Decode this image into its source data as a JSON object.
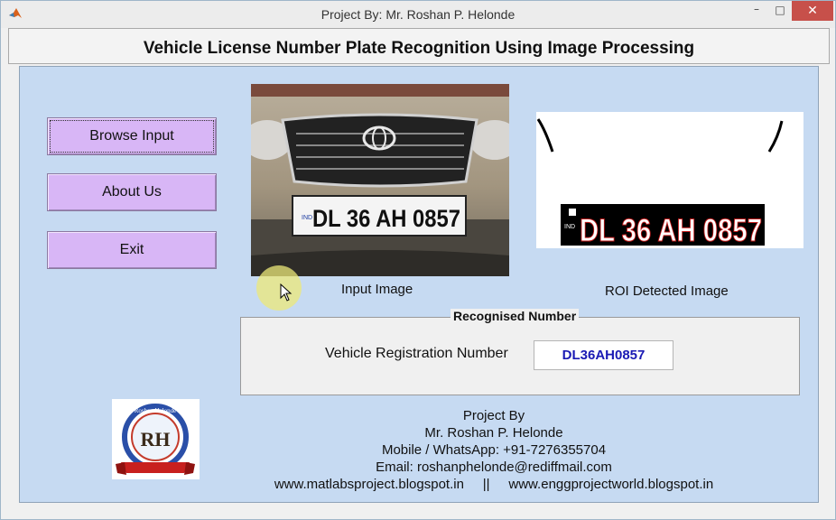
{
  "window": {
    "title": "Project By: Mr. Roshan P. Helonde",
    "minimize_glyph": "–",
    "maximize_glyph": "□",
    "close_glyph": "✕",
    "app_icon": "matlab-icon"
  },
  "header": {
    "title": "Vehicle License Number Plate Recognition Using Image Processing"
  },
  "buttons": {
    "browse": "Browse Input",
    "about": "About Us",
    "exit": "Exit"
  },
  "images": {
    "input_caption": "Input Image",
    "roi_caption": "ROI Detected Image",
    "plate_country": "IND",
    "plate_text": "DL 36 AH 0857",
    "roi_text": "DL 36 AH 0857"
  },
  "recognition": {
    "legend": "Recognised Number",
    "label": "Vehicle Registration Number",
    "value": "DL36AH0857"
  },
  "logo": {
    "top_text": "Roshan Helonde",
    "initials": "RH"
  },
  "credits": {
    "line1": "Project By",
    "line2": "Mr. Roshan P. Helonde",
    "line3": "Mobile / WhatsApp: +91-7276355704",
    "line4": "Email: roshanphelonde@rediffmail.com",
    "line5": "www.matlabsproject.blogspot.in     ||     www.enggprojectworld.blogspot.in"
  },
  "colors": {
    "panel_bg": "#c6daf2",
    "button_bg": "#d8b6f6",
    "value_text": "#1a1ab4",
    "close_bg": "#c7504a"
  }
}
